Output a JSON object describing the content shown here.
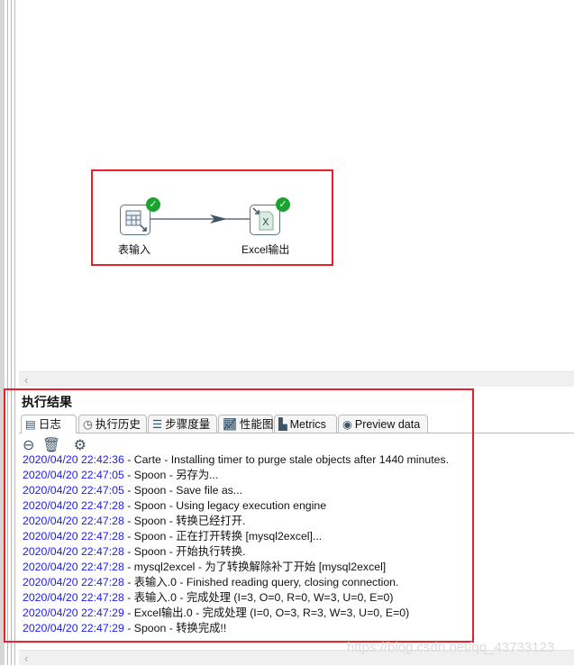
{
  "canvas": {
    "steps": [
      {
        "label": "表输入",
        "icon": "table-input-icon",
        "status": "success"
      },
      {
        "label": "Excel输出",
        "icon": "excel-output-icon",
        "status": "success"
      }
    ],
    "scroll_left": "‹"
  },
  "results": {
    "title": "执行结果",
    "tabs": [
      {
        "label": "日志",
        "icon": "log-icon"
      },
      {
        "label": "执行历史",
        "icon": "history-icon"
      },
      {
        "label": "步骤度量",
        "icon": "step-metrics-icon"
      },
      {
        "label": "性能图",
        "icon": "performance-chart-icon"
      },
      {
        "label": "Metrics",
        "icon": "metrics-icon"
      },
      {
        "label": "Preview data",
        "icon": "eye-icon"
      }
    ],
    "toolbar": [
      "stop-icon",
      "trash-icon",
      "gear-icon"
    ],
    "log": [
      {
        "ts": "2020/04/20 22:42:36",
        "msg": " - Carte - Installing timer to purge stale objects after 1440 minutes."
      },
      {
        "ts": "2020/04/20 22:47:05",
        "msg": " - Spoon - 另存为..."
      },
      {
        "ts": "2020/04/20 22:47:05",
        "msg": " - Spoon - Save file as..."
      },
      {
        "ts": "2020/04/20 22:47:28",
        "msg": " - Spoon - Using legacy execution engine"
      },
      {
        "ts": "2020/04/20 22:47:28",
        "msg": " - Spoon - 转换已经打开."
      },
      {
        "ts": "2020/04/20 22:47:28",
        "msg": " - Spoon - 正在打开转换 [mysql2excel]..."
      },
      {
        "ts": "2020/04/20 22:47:28",
        "msg": " - Spoon - 开始执行转换."
      },
      {
        "ts": "2020/04/20 22:47:28",
        "msg": " - mysql2excel - 为了转换解除补丁开始  [mysql2excel]"
      },
      {
        "ts": "2020/04/20 22:47:28",
        "msg": " - 表输入.0 - Finished reading query, closing connection."
      },
      {
        "ts": "2020/04/20 22:47:28",
        "msg": " - 表输入.0 - 完成处理 (I=3, O=0, R=0, W=3, U=0, E=0)"
      },
      {
        "ts": "2020/04/20 22:47:29",
        "msg": " - Excel输出.0 - 完成处理 (I=0, O=3, R=3, W=3, U=0, E=0)"
      },
      {
        "ts": "2020/04/20 22:47:29",
        "msg": " - Spoon - 转换完成!!"
      }
    ]
  },
  "watermark": "https://blog.csdn.net/qq_43733123",
  "colors": {
    "highlight": "#e8202a",
    "timestamp": "#1a1aff",
    "success": "#1ca32f"
  }
}
